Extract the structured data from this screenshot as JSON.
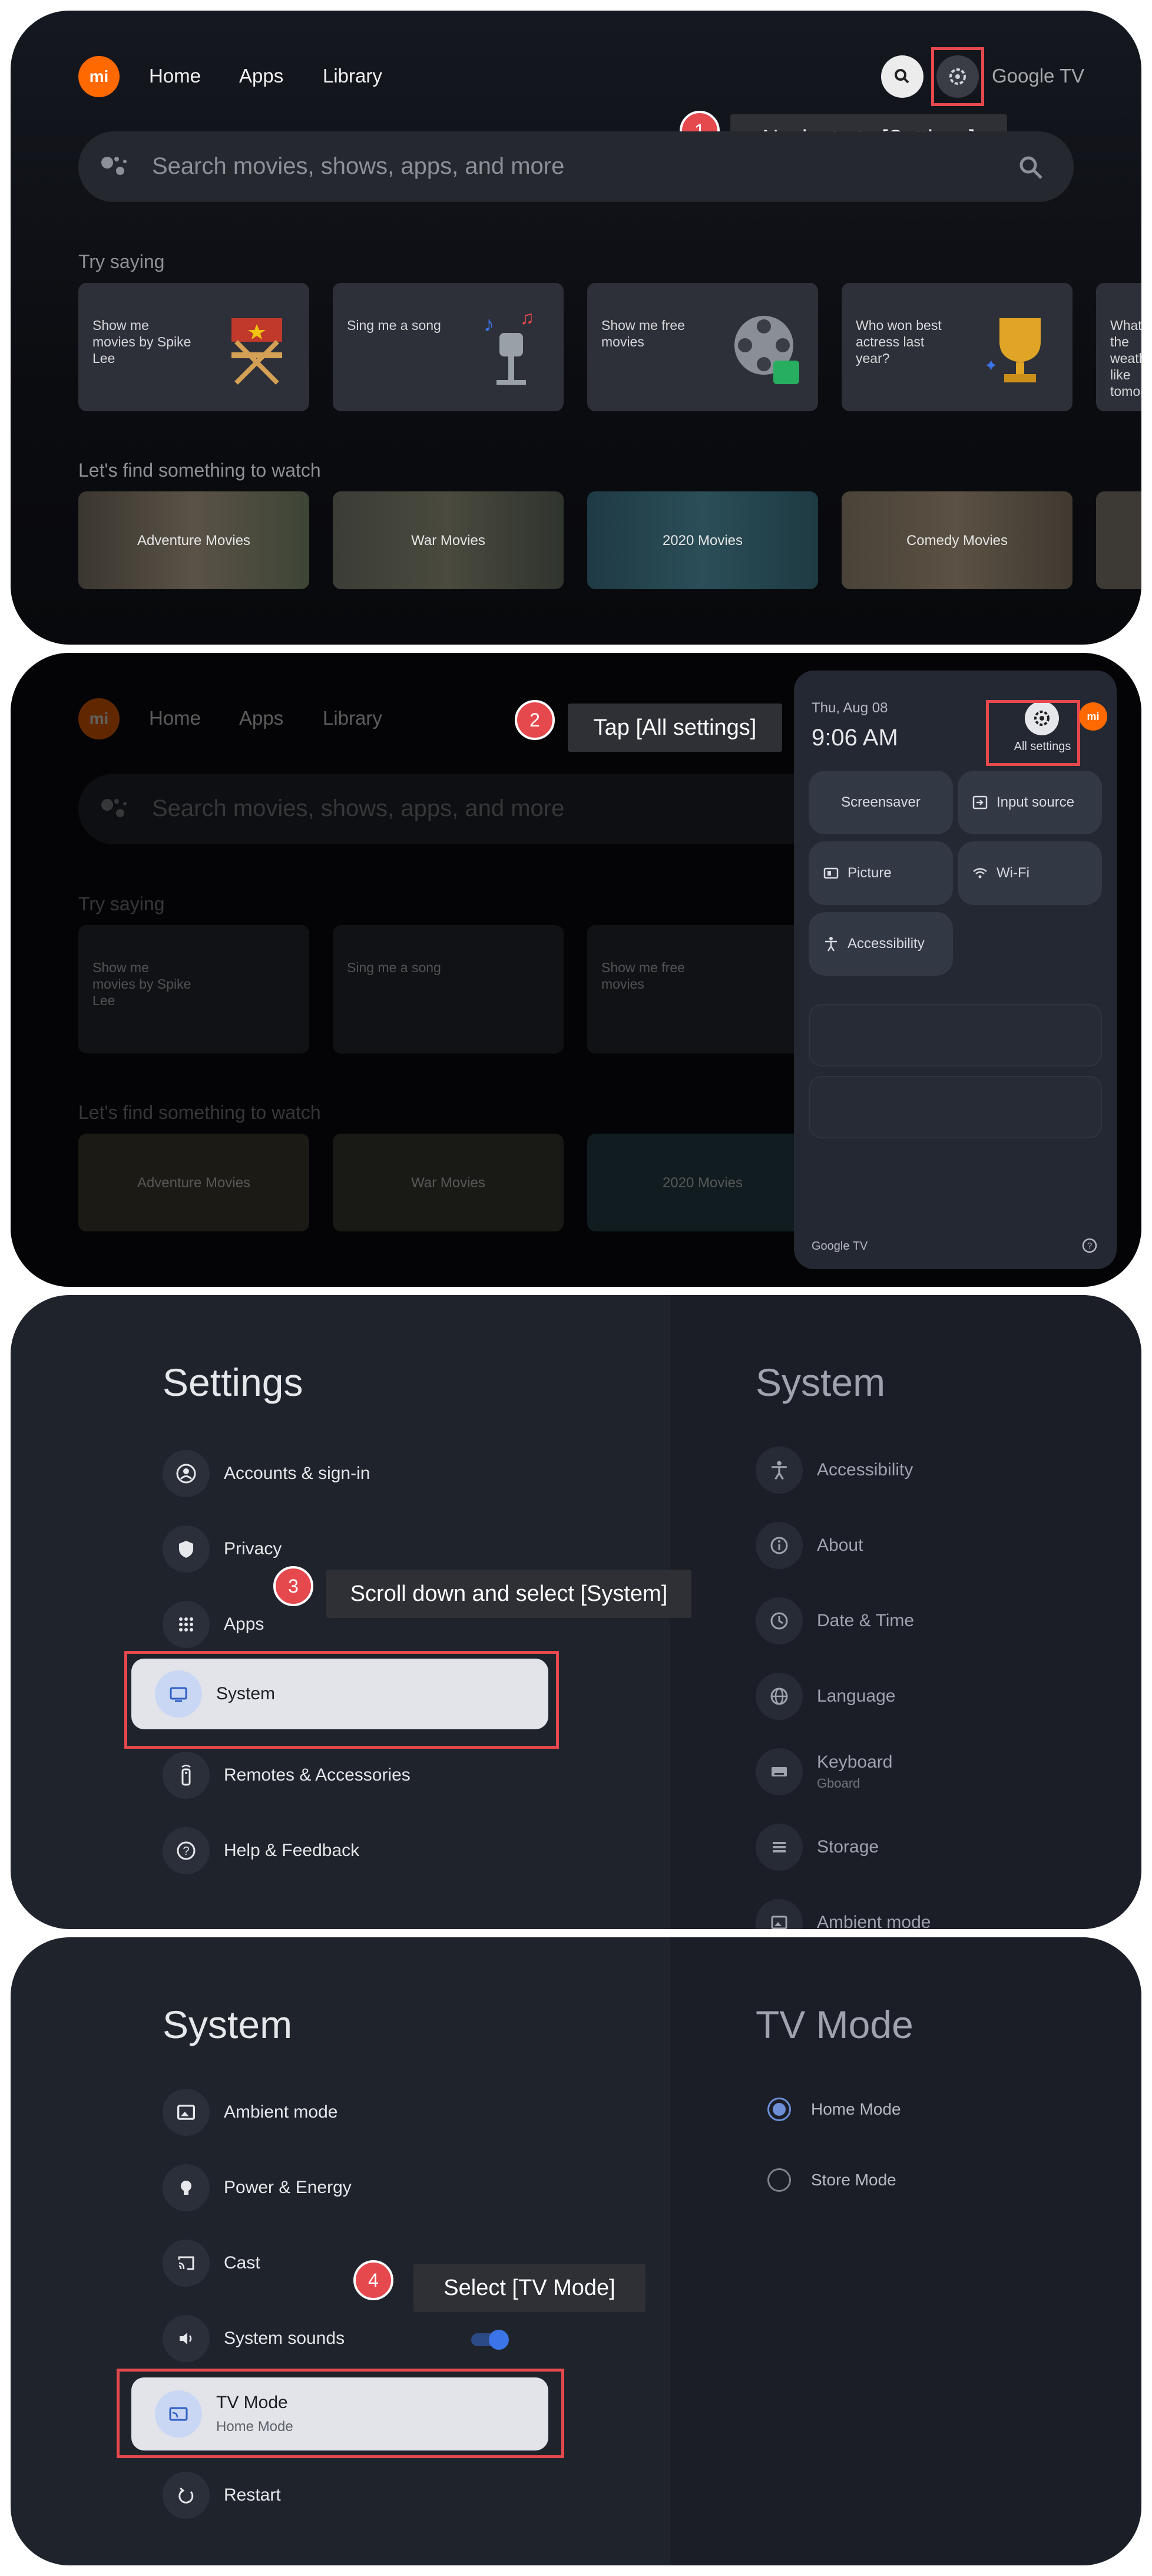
{
  "colors": {
    "accent": "#e5484d",
    "brand": "#ff6900",
    "toggle": "#3b74e8"
  },
  "topbar": {
    "logo": "mi",
    "nav": [
      "Home",
      "Apps",
      "Library"
    ],
    "brand_text": "Google TV"
  },
  "search": {
    "placeholder": "Search movies, shows, apps, and more"
  },
  "try_saying": {
    "title": "Try saying",
    "cards": [
      "Show me movies by Spike Lee",
      "Sing me a song",
      "Show me free movies",
      "Who won best actress last year?",
      "What's the weather like tomorrow?"
    ]
  },
  "watch": {
    "title": "Let's find something to watch",
    "tiles": [
      "Adventure Movies",
      "War Movies",
      "2020 Movies",
      "Comedy Movies"
    ]
  },
  "steps": [
    {
      "num": "1",
      "text": "Navigate to [Settings]"
    },
    {
      "num": "2",
      "text": "Tap [All settings]"
    },
    {
      "num": "3",
      "text": "Scroll down and select [System]"
    },
    {
      "num": "4",
      "text": "Select [TV Mode]"
    }
  ],
  "quick_settings": {
    "date": "Thu, Aug 08",
    "time": "9:06 AM",
    "all_settings": "All settings",
    "buttons": [
      "Screensaver",
      "Input source",
      "Picture",
      "Wi-Fi",
      "Accessibility"
    ],
    "footer": "Google TV",
    "help_icon": "help-circle-icon"
  },
  "settings": {
    "title": "Settings",
    "items": [
      "Accounts & sign-in",
      "Privacy",
      "Apps",
      "System",
      "Remotes & Accessories",
      "Help & Feedback"
    ],
    "preview_title": "System",
    "preview_items": [
      "Accessibility",
      "About",
      "Date & Time",
      "Language",
      "Keyboard",
      "Storage",
      "Ambient mode"
    ],
    "keyboard_sub": "Gboard"
  },
  "system": {
    "title": "System",
    "items": [
      "Ambient mode",
      "Power & Energy",
      "Cast",
      "System sounds",
      "TV Mode",
      "Restart"
    ],
    "tv_mode_sub": "Home Mode",
    "system_sounds_on": true
  },
  "tv_mode": {
    "title": "TV Mode",
    "options": [
      "Home Mode",
      "Store Mode"
    ],
    "selected": "Home Mode"
  }
}
